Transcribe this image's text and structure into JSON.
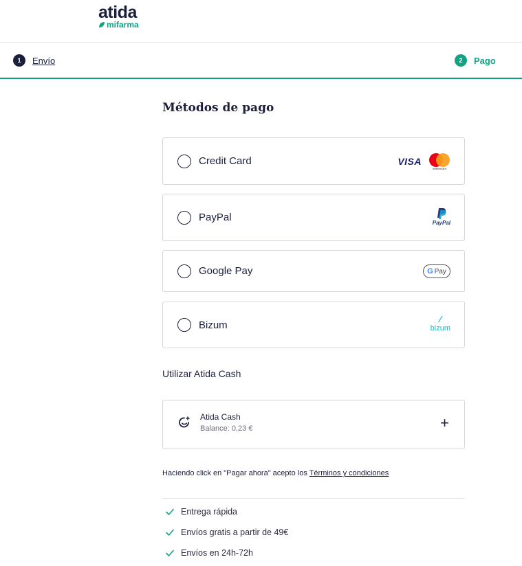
{
  "brand": {
    "name": "atida",
    "sub": "mifarma",
    "accent": "#15a284"
  },
  "steps": [
    {
      "num": "1",
      "label": "Envío"
    },
    {
      "num": "2",
      "label": "Pago"
    }
  ],
  "payment": {
    "title": "Métodos de pago",
    "methods": [
      {
        "label": "Credit Card",
        "logos": [
          "VISA",
          "mastercard"
        ]
      },
      {
        "label": "PayPal",
        "logos": [
          "PayPal"
        ]
      },
      {
        "label": "Google Pay",
        "logos": [
          "Pay"
        ]
      },
      {
        "label": "Bizum",
        "logos": [
          "bizum"
        ]
      }
    ]
  },
  "cash": {
    "title": "Utilizar Atida Cash",
    "name": "Atida Cash",
    "balance": "Balance: 0,23 €",
    "add": "+"
  },
  "terms": {
    "text": "Haciendo click en \"Pagar ahora\" acepto los ",
    "link": "Términos y condiciones"
  },
  "benefits": [
    "Entrega rápida",
    "Envíos gratis a partir de 49€",
    "Envíos en 24h-72h"
  ]
}
